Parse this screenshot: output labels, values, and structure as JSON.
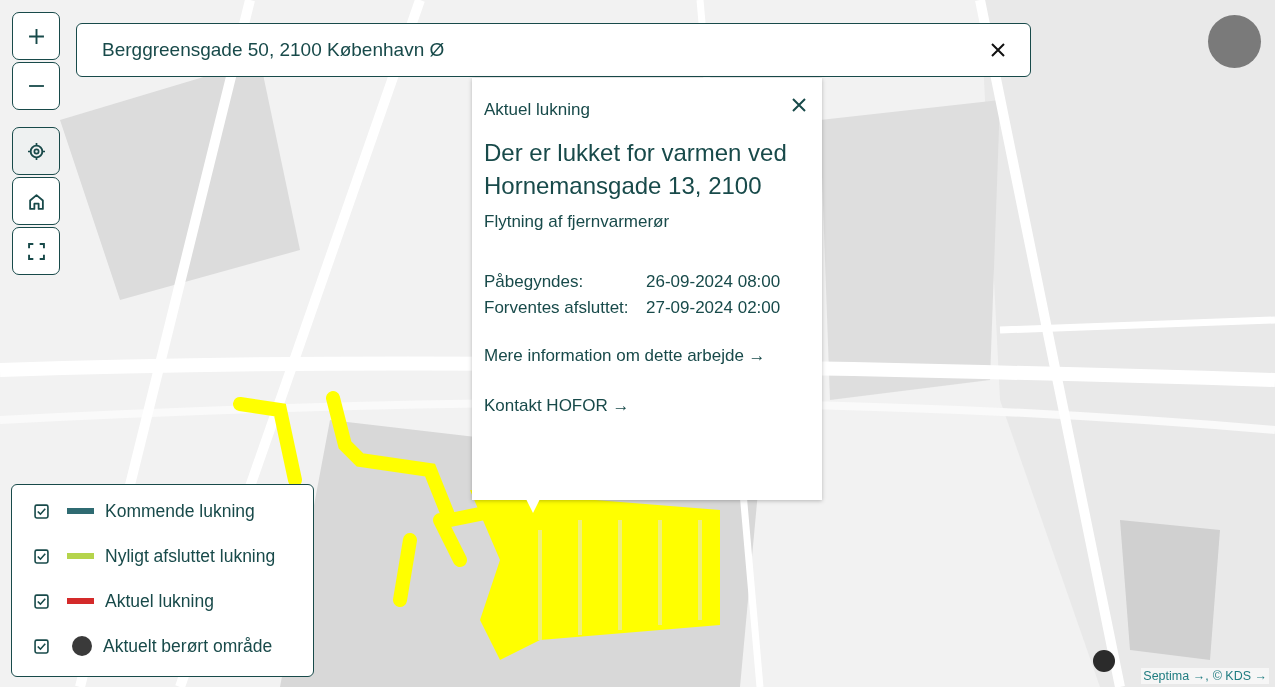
{
  "map_controls": [
    {
      "active": false
    },
    {
      "active": false
    },
    {
      "active": true
    },
    {
      "active": false
    },
    {
      "active": false
    }
  ],
  "search": {
    "value": "Berggreensgade 50, 2100 København Ø"
  },
  "popup": {
    "category": "Aktuel lukning",
    "title": "Der er lukket for varmen ved Hornemansgade 13, 2100",
    "subtitle": "Flytning af fjernvarmerør",
    "details": [
      {
        "label": "Påbegyndes:",
        "value": "26-09-2024 08:00"
      },
      {
        "label": "Forventes afsluttet:",
        "value": "27-09-2024 02:00"
      }
    ],
    "links": [
      "Mere information om dette arbejde →",
      "Kontakt HOFOR →"
    ]
  },
  "legend": [
    {
      "kind": "line",
      "label": "Kommende lukning",
      "color": "#2f6b72",
      "checked": true
    },
    {
      "kind": "line",
      "label": "Nyligt afsluttet lukning",
      "color": "#b5d44c",
      "checked": true
    },
    {
      "kind": "line",
      "label": "Aktuel lukning",
      "color": "#d42a2a",
      "checked": true
    },
    {
      "kind": "dot",
      "label": "Aktuelt berørt område",
      "color": "#3a3a3a",
      "checked": true
    }
  ],
  "attribution": {
    "separator": ",",
    "links": [
      "Septima →",
      "© KDS →"
    ]
  }
}
